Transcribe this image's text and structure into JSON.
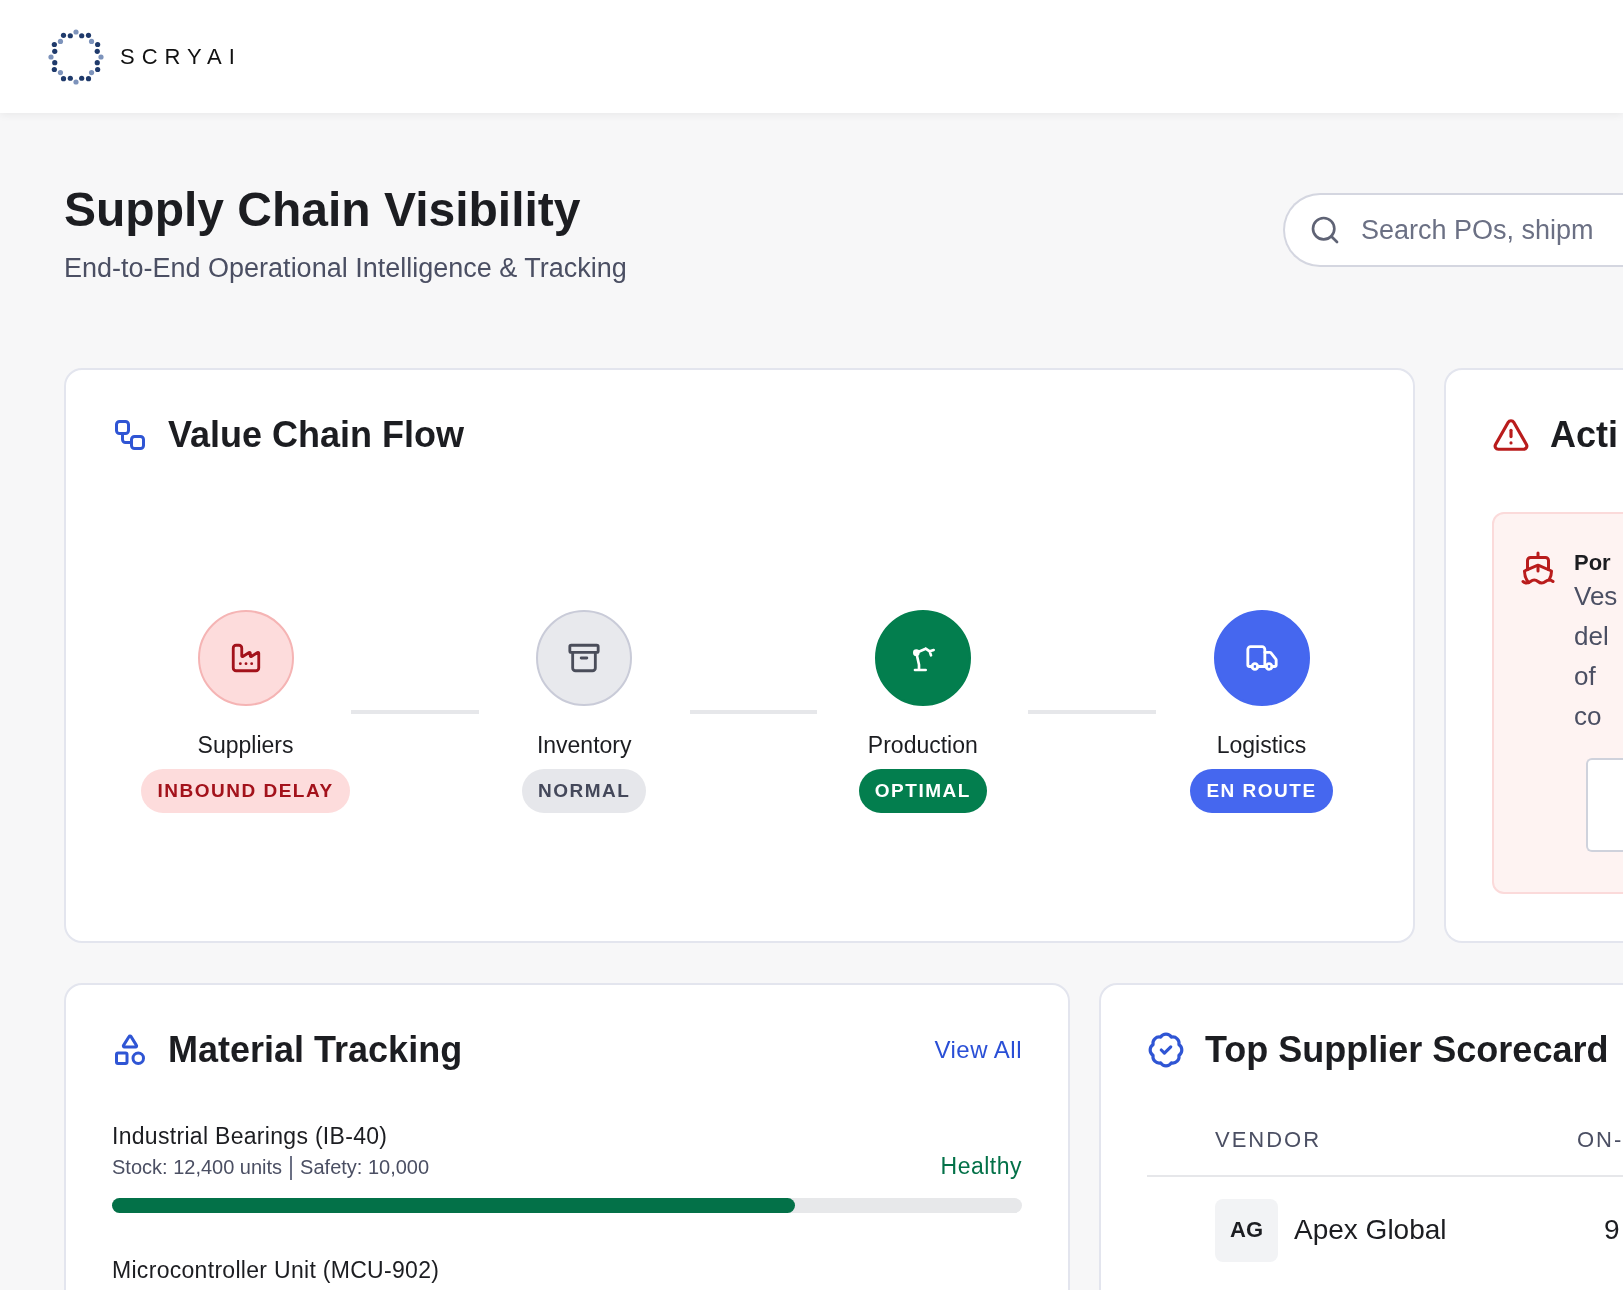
{
  "brand": {
    "name": "SCRYAI"
  },
  "page": {
    "title": "Supply Chain Visibility",
    "subtitle": "End-to-End Operational Intelligence & Tracking"
  },
  "search": {
    "placeholder": "Search POs, shipm"
  },
  "value_chain": {
    "title": "Value Chain Flow",
    "stages": [
      {
        "name": "Suppliers",
        "status": "INBOUND DELAY",
        "kind": "alert"
      },
      {
        "name": "Inventory",
        "status": "NORMAL",
        "kind": "neutral"
      },
      {
        "name": "Production",
        "status": "OPTIMAL",
        "kind": "good"
      },
      {
        "name": "Logistics",
        "status": "EN ROUTE",
        "kind": "transit"
      }
    ]
  },
  "alerts": {
    "title": "Acti",
    "items": [
      {
        "title": "Por",
        "lines": [
          "Ves",
          "del",
          "of",
          "co"
        ]
      }
    ]
  },
  "materials": {
    "title": "Material Tracking",
    "link": "View All",
    "items": [
      {
        "name": "Industrial Bearings (IB-40)",
        "stock": "Stock: 12,400 units",
        "safety": "Safety: 10,000",
        "status": "Healthy",
        "kind": "healthy",
        "level": 0.75
      },
      {
        "name": "Microcontroller Unit (MCU-902)"
      }
    ]
  },
  "scorecard": {
    "title": "Top Supplier Scorecard",
    "columns": [
      "VENDOR",
      "ON-"
    ],
    "rows": [
      {
        "initials": "AG",
        "vendor": "Apex Global",
        "column_2": "9"
      }
    ]
  }
}
